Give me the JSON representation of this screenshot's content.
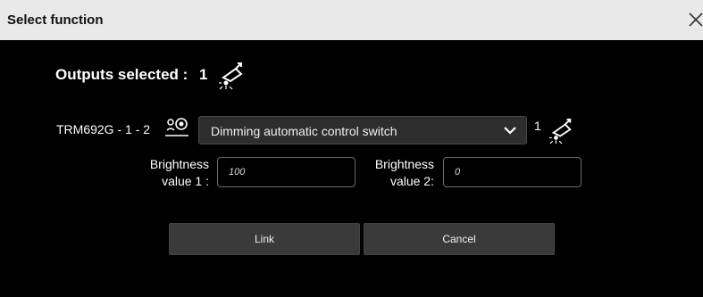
{
  "dialog": {
    "title": "Select function",
    "close_glyph": "✕",
    "outputs_selected_label": "Outputs selected :",
    "outputs_selected_count": "1",
    "outputs_icon": "dimmable-light-output-icon",
    "device": {
      "label": "TRM692G - 1 - 2",
      "sensor_icon": "presence-sensor-icon",
      "function_selected": "Dimming automatic control switch",
      "output_count": "1"
    },
    "brightness1": {
      "label_line1": "Brightness",
      "label_line2": "value 1 :",
      "value": "100"
    },
    "brightness2": {
      "label_line1": "Brightness",
      "label_line2": "value 2:",
      "value": "0"
    },
    "buttons": {
      "link": "Link",
      "cancel": "Cancel"
    }
  }
}
